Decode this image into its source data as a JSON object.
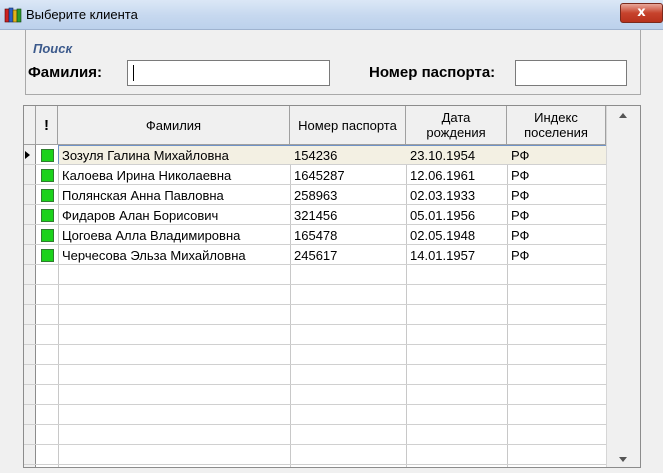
{
  "window": {
    "title": "Выберите клиента",
    "close_label": "x"
  },
  "search": {
    "caption": "Поиск",
    "surname_label": "Фамилия:",
    "surname_value": "",
    "passport_label": "Номер паспорта:",
    "passport_value": ""
  },
  "table": {
    "headers": {
      "flag": "!",
      "name": "Фамилия",
      "passport": "Номер паспорта",
      "birth_date": "Дата рождения",
      "settlement_index": "Индекс поселения"
    },
    "rows": [
      {
        "name": "Зозуля Галина Михайловна",
        "passport": "154236",
        "birth_date": "23.10.1954",
        "index": "РФ"
      },
      {
        "name": "Калоева Ирина Николаевна",
        "passport": "1645287",
        "birth_date": "12.06.1961",
        "index": "РФ"
      },
      {
        "name": "Полянская Анна Павловна",
        "passport": "258963",
        "birth_date": "02.03.1933",
        "index": "РФ"
      },
      {
        "name": "Фидаров Алан Борисович",
        "passport": "321456",
        "birth_date": "05.01.1956",
        "index": "РФ"
      },
      {
        "name": "Цогоева Алла Владимировна",
        "passport": "165478",
        "birth_date": "02.05.1948",
        "index": "РФ"
      },
      {
        "name": "Черчесова Эльза Михайловна",
        "passport": "245617",
        "birth_date": "14.01.1957",
        "index": "РФ"
      }
    ],
    "selected_row": 0,
    "status_color": "#1bd21b",
    "empty_row_count": 11
  },
  "icons": {
    "app": "books-icon",
    "flag": "green-square-icon"
  }
}
